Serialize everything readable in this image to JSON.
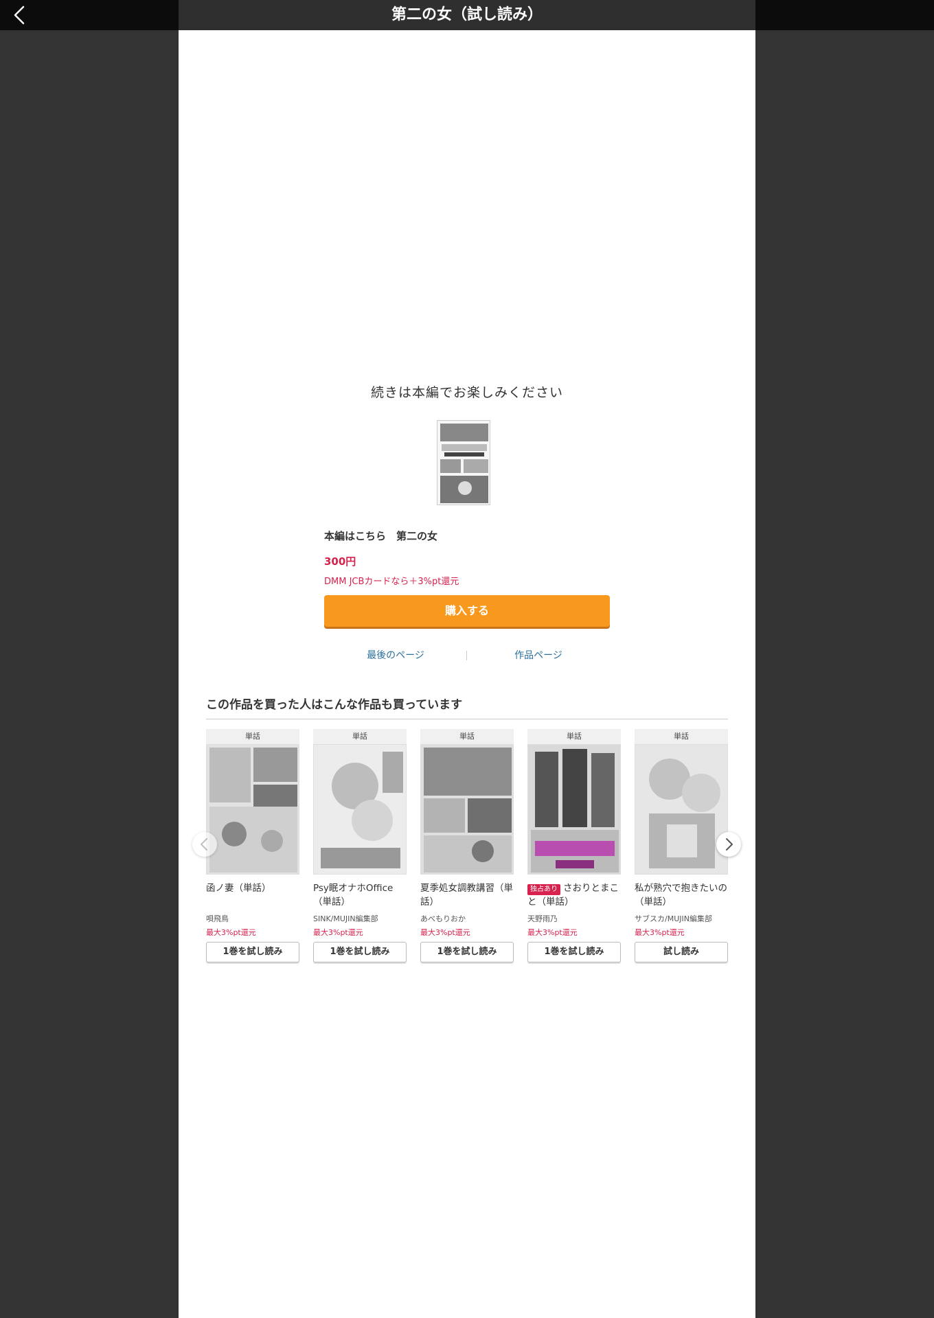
{
  "header": {
    "title": "第二の女（試し読み）",
    "back_icon": "chevron-left-icon"
  },
  "end_of_preview": {
    "message": "続きは本編でお楽しみください",
    "product_label": "本編はこちら　第二の女",
    "price": "300円",
    "campaign": "DMM JCBカードなら＋3%pt還元",
    "buy_label": "購入する",
    "buy_color": "#f8991d",
    "links": {
      "last_page": "最後のページ",
      "work_page": "作品ページ"
    }
  },
  "recommendations": {
    "title": "この作品を買った人はこんな作品も買っています",
    "prev_icon": "chevron-left-icon",
    "next_icon": "chevron-right-icon",
    "items": [
      {
        "tag": "単話",
        "exclusive": "",
        "title": "函ノ妻（単話）",
        "author": "唄飛鳥",
        "points": "最大3%pt還元",
        "button": "1巻を試し読み"
      },
      {
        "tag": "単話",
        "exclusive": "",
        "title": "Psy眠オナホOffice（単話）",
        "author": "SINK/MUJIN編集部",
        "points": "最大3%pt還元",
        "button": "1巻を試し読み"
      },
      {
        "tag": "単話",
        "exclusive": "",
        "title": "夏季処女調教講習（単話）",
        "author": "あべもりおか",
        "points": "最大3%pt還元",
        "button": "1巻を試し読み"
      },
      {
        "tag": "単話",
        "exclusive": "独占あり",
        "title": "さおりとまこと（単話）",
        "author": "天野雨乃",
        "points": "最大3%pt還元",
        "button": "1巻を試し読み"
      },
      {
        "tag": "単話",
        "exclusive": "",
        "title": "私が熟穴で抱きたいの（単話）",
        "author": "サブスカ/MUJIN編集部",
        "points": "最大3%pt還元",
        "button": "試し読み"
      }
    ]
  }
}
